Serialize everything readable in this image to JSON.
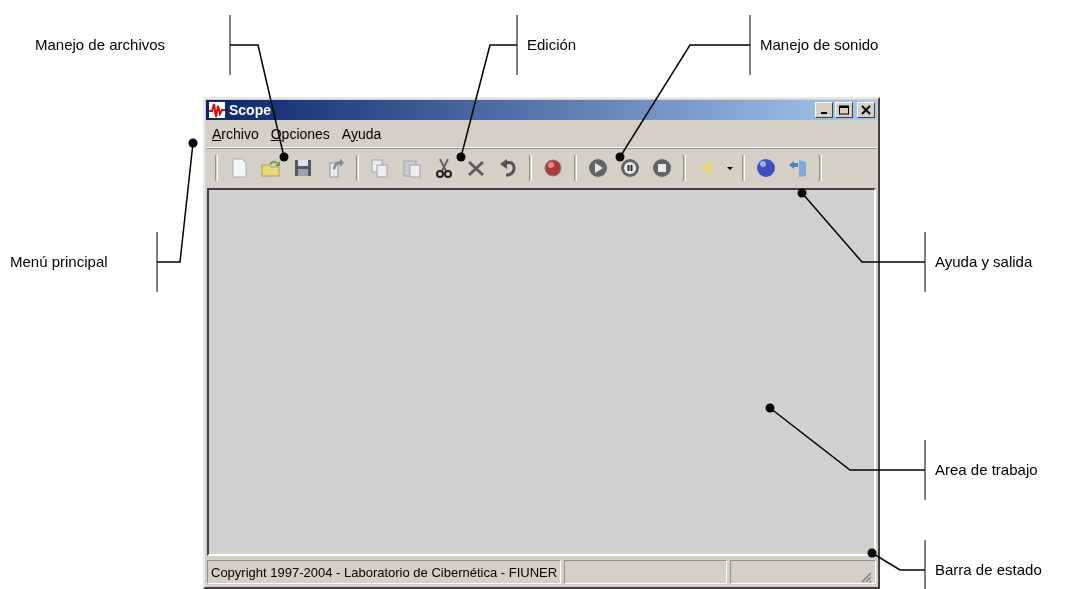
{
  "callouts": [
    {
      "text": "Manejo de archivos"
    },
    {
      "text": "Edición"
    },
    {
      "text": "Manejo de sonido"
    },
    {
      "text": "Menú principal"
    },
    {
      "text": "Ayuda y salida"
    },
    {
      "text": "Area de trabajo"
    },
    {
      "text": "Barra de estado"
    }
  ],
  "window": {
    "title": "Scope"
  },
  "menu": [
    {
      "parts": [
        {
          "text": "A",
          "underline": true
        },
        {
          "text": "rchivo",
          "underline": false
        }
      ]
    },
    {
      "parts": [
        {
          "text": "O",
          "underline": true
        },
        {
          "text": "pciones",
          "underline": false
        }
      ]
    },
    {
      "parts": [
        {
          "text": "A",
          "underline": false
        },
        {
          "text": "y",
          "underline": true
        },
        {
          "text": "uda",
          "underline": false
        }
      ]
    }
  ],
  "toolbar": [
    {
      "kind": "separator"
    },
    {
      "kind": "new"
    },
    {
      "kind": "open"
    },
    {
      "kind": "save"
    },
    {
      "kind": "export"
    },
    {
      "kind": "separator"
    },
    {
      "kind": "copy"
    },
    {
      "kind": "paste"
    },
    {
      "kind": "cut"
    },
    {
      "kind": "delete"
    },
    {
      "kind": "undo"
    },
    {
      "kind": "separator"
    },
    {
      "kind": "record"
    },
    {
      "kind": "separator"
    },
    {
      "kind": "play"
    },
    {
      "kind": "pause"
    },
    {
      "kind": "stop"
    },
    {
      "kind": "separator"
    },
    {
      "kind": "volume"
    },
    {
      "kind": "dropdown"
    },
    {
      "kind": "separator"
    },
    {
      "kind": "help"
    },
    {
      "kind": "exit"
    },
    {
      "kind": "separator"
    }
  ],
  "status_bar": [
    "Copyright 1997-2004 - Laboratorio de Cibernética - FIUNER"
  ]
}
